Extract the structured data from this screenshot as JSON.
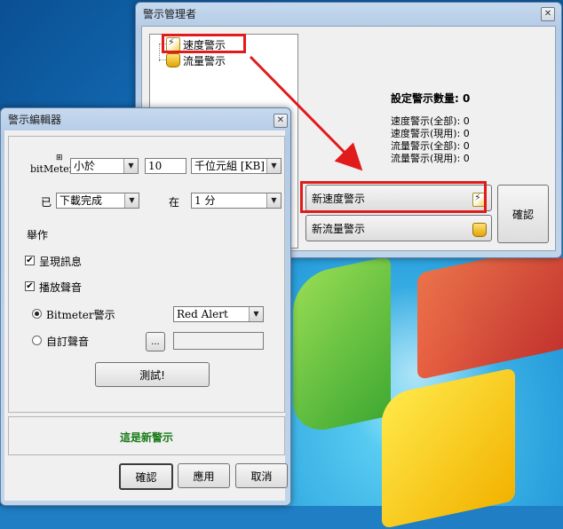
{
  "manager": {
    "title": "警示管理者",
    "close_label": "✕",
    "tree": [
      {
        "label": "速度警示",
        "icon": "speed-alert-icon"
      },
      {
        "label": "流量警示",
        "icon": "traffic-alert-icon"
      }
    ],
    "summary_title": "設定警示數量: 0",
    "summary_lines": [
      "速度警示(全部): 0",
      "速度警示(現用): 0",
      "流量警示(全部): 0",
      "流量警示(現用): 0"
    ],
    "new_speed_label": "新速度警示",
    "new_traffic_label": "新流量警示",
    "ok_label": "確認"
  },
  "editor": {
    "title": "警示編輯器",
    "close_label": "✕",
    "bitmeter_label": "bitMeter",
    "bitmeter_sup": "⊞",
    "compare_value": "小於",
    "amount_value": "10",
    "unit_value": "千位元組 [KB]",
    "already_label": "已",
    "direction_value": "下載完成",
    "within_label": "在",
    "period_value": "1 分",
    "actions_label": "舉作",
    "show_message_label": "呈現訊息",
    "play_sound_label": "播放聲音",
    "bitmeter_sound_label": "Bitmeter警示",
    "bitmeter_sound_value": "Red Alert",
    "custom_sound_label": "自訂聲音",
    "browse_label": "...",
    "custom_sound_path": "",
    "test_label": "測試!",
    "status_text": "這是新警示",
    "ok_label": "確認",
    "apply_label": "應用",
    "cancel_label": "取消"
  },
  "colors": {
    "highlight": "#e11b1b",
    "status_green": "#1a7a1a"
  }
}
